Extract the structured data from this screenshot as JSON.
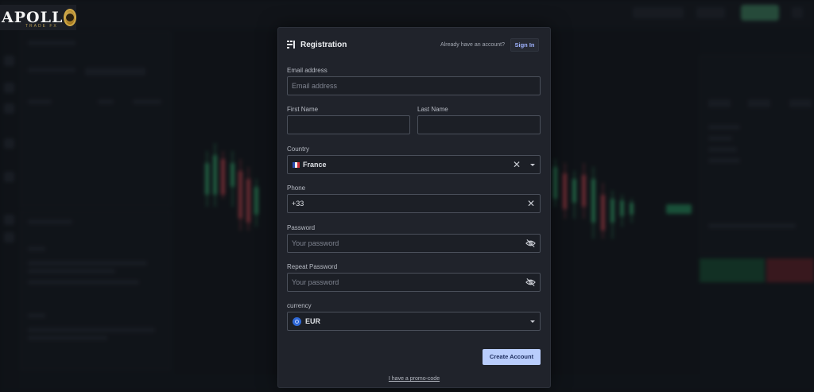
{
  "brand": {
    "name": "APOLL",
    "tagline": "TRADE FX"
  },
  "modal": {
    "title_icon": "registration-icon",
    "title": "Registration",
    "already_text": "Already have an account?",
    "signin_label": "Sign In",
    "email": {
      "label": "Email address",
      "placeholder": "Email address",
      "value": ""
    },
    "first_name": {
      "label": "First Name",
      "value": ""
    },
    "last_name": {
      "label": "Last Name",
      "value": ""
    },
    "country": {
      "label": "Country",
      "value": "France",
      "flag_icon": "france-flag-icon"
    },
    "phone": {
      "label": "Phone",
      "value": "+33"
    },
    "password": {
      "label": "Password",
      "placeholder": "Your password",
      "value": ""
    },
    "repeat_password": {
      "label": "Repeat Password",
      "placeholder": "Your password",
      "value": ""
    },
    "currency": {
      "label": "currency",
      "value": "EUR",
      "icon": "eur-coin-icon"
    },
    "create_label": "Create Account",
    "promo_label": "I have a promo-code"
  },
  "colors": {
    "accent": "#b9cdfc",
    "link": "#9fb3ff",
    "modal_bg": "#20232b",
    "candle_up": "#3ec07d",
    "candle_down": "#e0505b"
  }
}
